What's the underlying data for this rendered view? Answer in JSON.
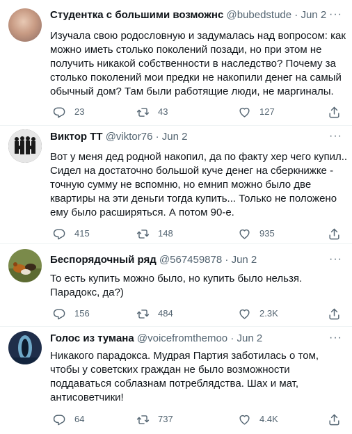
{
  "tweets": [
    {
      "name": "Студентка с большими возможнс",
      "handle": "@bubedstude",
      "date": "Jun 2",
      "text": "Изучала свою родословную и задумалась над вопросом: как\nможно иметь столько поколений позади, но при этом не\nполучить никакой собственности в наследство? Почему за\nстолько поколений мои предки не накопили денег на самый\nобычный дом? Там были работящие люди, не маргиналы.",
      "replies": "23",
      "retweets": "43",
      "likes": "127"
    },
    {
      "name": "Виктор ТТ",
      "handle": "@viktor76",
      "date": "Jun 2",
      "text": "Вот у меня дед родной накопил, да по факту хер чего купил..\nСидел на достаточно большой куче денег на сберкнижке -\nточную сумму не вспомню, но емнип можно было две\nквартиры на эти деньги тогда купить... Только не положено\nему было расширяться. А потом 90-е.",
      "replies": "415",
      "retweets": "148",
      "likes": "935"
    },
    {
      "name": "Беспорядочный ряд",
      "handle": "@567459878",
      "date": "Jun 2",
      "text": "То есть купить можно было, но купить было нельзя.\nПарадокс, да?)",
      "replies": "156",
      "retweets": "484",
      "likes": "2.3K"
    },
    {
      "name": "Голос из тумана",
      "handle": "@voicefromthemoo",
      "date": "Jun 2",
      "text": "Никакого парадокса. Мудрая Партия заботилась о том,\nчтобы у советских граждан не было возможности\nподдаваться соблазнам потреблядства. Шах и мат,\nантисоветчики!",
      "replies": "64",
      "retweets": "737",
      "likes": "4.4K"
    }
  ],
  "separator": "·",
  "more_glyph": "···"
}
